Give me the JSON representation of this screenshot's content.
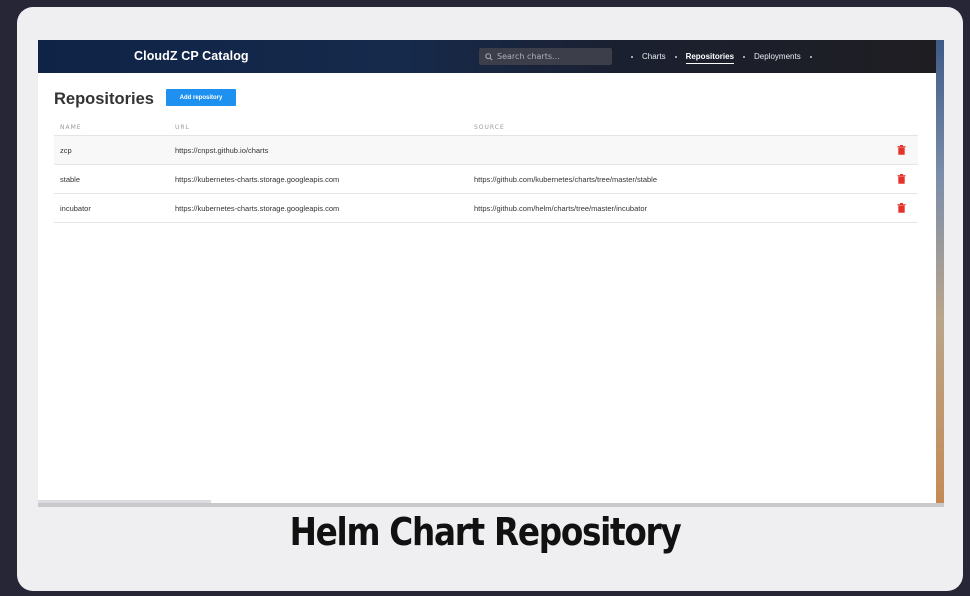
{
  "app": {
    "brand": "CloudZ CP Catalog"
  },
  "search": {
    "placeholder": "Search charts..."
  },
  "nav": {
    "charts": "Charts",
    "repositories": "Repositories",
    "deployments": "Deployments"
  },
  "page": {
    "title": "Repositories",
    "add_button": "Add repository"
  },
  "table": {
    "headers": {
      "name": "NAME",
      "url": "URL",
      "source": "SOURCE"
    },
    "rows": [
      {
        "name": "zcp",
        "url": "https://cnpst.github.io/charts",
        "source": ""
      },
      {
        "name": "stable",
        "url": "https://kubernetes-charts.storage.googleapis.com",
        "source": "https://github.com/kubernetes/charts/tree/master/stable"
      },
      {
        "name": "incubator",
        "url": "https://kubernetes-charts.storage.googleapis.com",
        "source": "https://github.com/helm/charts/tree/master/incubator"
      }
    ]
  },
  "caption": "Helm Chart Repository",
  "colors": {
    "accent": "#1e90ef",
    "delete": "#e5332a",
    "topbar": "#0f2347"
  }
}
